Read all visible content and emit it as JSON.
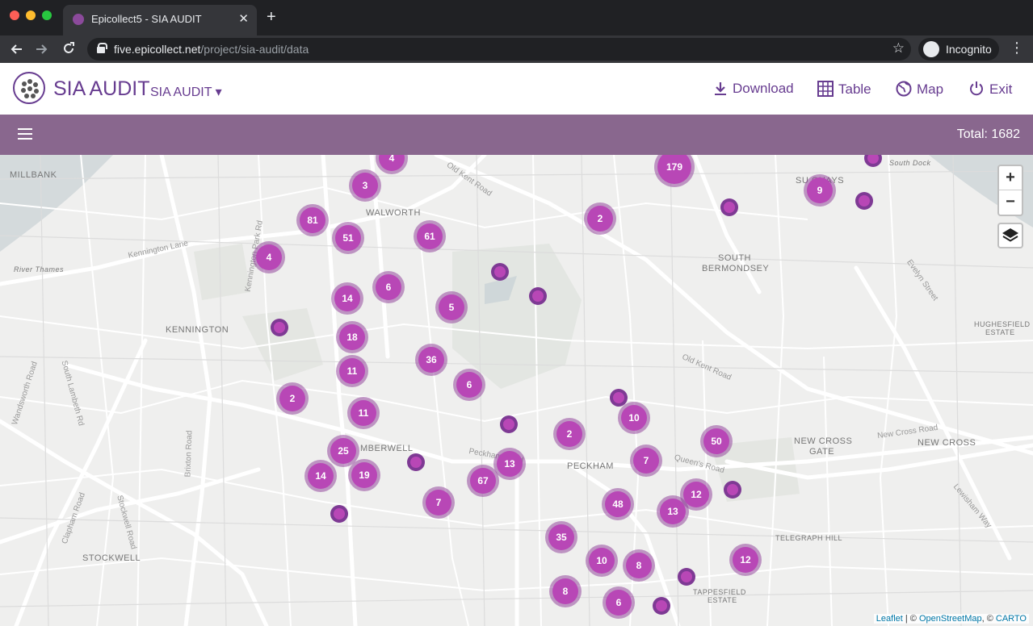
{
  "browser": {
    "tab_title": "Epicollect5 - SIA AUDIT",
    "tab_close": "✕",
    "new_tab": "+",
    "url_domain": "five.epicollect.net",
    "url_path": "/project/sia-audit/data",
    "incognito_label": "Incognito"
  },
  "header": {
    "title": "SIA AUDIT",
    "project_dropdown": "SIA AUDIT ▾",
    "nav": {
      "download": "Download",
      "table": "Table",
      "map": "Map",
      "exit": "Exit"
    },
    "accent_color": "#673c90"
  },
  "bar": {
    "total": "Total: 1682",
    "color": "#89678e"
  },
  "map": {
    "zoom_in": "+",
    "zoom_out": "−",
    "places": {
      "millbank": "MILLBANK",
      "walworth": "WALWORTH",
      "south_bermondsey": "SOUTH",
      "south_bermondsey_2": "BERMONDSEY",
      "kennington": "KENNINGTON",
      "camberwell": "MBERWELL",
      "peckham": "PECKHAM",
      "new_cross_gate": "NEW CROSS",
      "new_cross_gate_2": "GATE",
      "new_cross": "NEW CROSS",
      "stockwell": "STOCKWELL",
      "telegraph_hill": "TELEGRAPH HILL",
      "hughesfield": "HUGHESFIELD",
      "hughesfield_2": "ESTATE",
      "tappesfield": "TAPPESFIELD",
      "tappesfield_2": "ESTATE",
      "surrey_quays": "SU    QUAYS",
      "south_dock": "South Dock",
      "river_thames": "River Thames"
    },
    "roads": {
      "old_kent_road_1": "Old Kent Road",
      "old_kent_road_2": "Old Kent Road",
      "kennington_lane": "Kennington Lane",
      "kennington_park_rd": "Kennington Park Rd",
      "brixton_road": "Brixton Road",
      "clapham_road": "Clapham Road",
      "stockwell_road": "Stockwell Road",
      "queens_road": "Queen's Road",
      "new_cross_road": "New Cross Road",
      "evelyn_street": "Evelyn Street",
      "lewisham_way": "Lewisham Way",
      "south_lambeth_rd": "South Lambeth Rd",
      "wandsworth_road": "Wandsworth Road",
      "peckham_road": "Peckham Road"
    },
    "clusters": [
      "4",
      "179",
      "9",
      "3",
      "81",
      "51",
      "61",
      "2",
      "4",
      "14",
      "6",
      "5",
      "18",
      "36",
      "11",
      "6",
      "2",
      "11",
      "10",
      "2",
      "50",
      "25",
      "14",
      "19",
      "13",
      "67",
      "7",
      "7",
      "12",
      "48",
      "13",
      "35",
      "12",
      "10",
      "8",
      "8",
      "6"
    ],
    "attribution": {
      "leaflet": "Leaflet",
      "sep": " | © ",
      "osm": "OpenStreetMap",
      "sep2": ", © ",
      "carto": "CARTO"
    }
  }
}
